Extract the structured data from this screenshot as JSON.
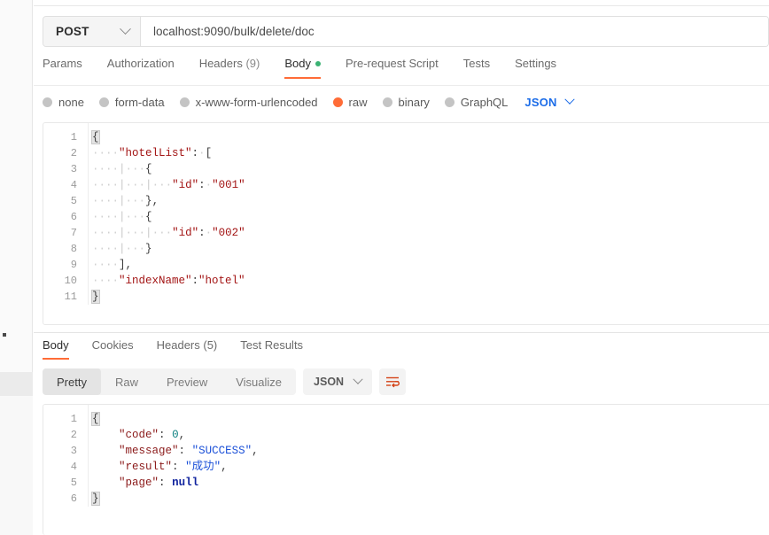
{
  "request": {
    "method": "POST",
    "url": "localhost:9090/bulk/delete/doc",
    "tabs": [
      {
        "label": "Params",
        "active": false,
        "count": ""
      },
      {
        "label": "Authorization",
        "active": false,
        "count": ""
      },
      {
        "label": "Headers",
        "active": false,
        "count": "(9)"
      },
      {
        "label": "Body",
        "active": true,
        "count": "",
        "dot": true
      },
      {
        "label": "Pre-request Script",
        "active": false,
        "count": ""
      },
      {
        "label": "Tests",
        "active": false,
        "count": ""
      },
      {
        "label": "Settings",
        "active": false,
        "count": ""
      }
    ],
    "body_types": [
      {
        "label": "none",
        "selected": false
      },
      {
        "label": "form-data",
        "selected": false
      },
      {
        "label": "x-www-form-urlencoded",
        "selected": false
      },
      {
        "label": "raw",
        "selected": true
      },
      {
        "label": "binary",
        "selected": false
      },
      {
        "label": "GraphQL",
        "selected": false
      }
    ],
    "format": "JSON",
    "body_lines": [
      {
        "n": "1",
        "segments": [
          {
            "t": "brace-hl",
            "v": "{"
          }
        ]
      },
      {
        "n": "2",
        "segments": [
          {
            "t": "ws",
            "v": "····"
          },
          {
            "t": "key",
            "v": "\"hotelList\""
          },
          {
            "t": "punc",
            "v": ":"
          },
          {
            "t": "ws",
            "v": "·"
          },
          {
            "t": "punc",
            "v": "["
          }
        ]
      },
      {
        "n": "3",
        "segments": [
          {
            "t": "ws",
            "v": "····"
          },
          {
            "t": "guide",
            "v": "|"
          },
          {
            "t": "ws",
            "v": "···"
          },
          {
            "t": "brace",
            "v": "{"
          }
        ]
      },
      {
        "n": "4",
        "segments": [
          {
            "t": "ws",
            "v": "····"
          },
          {
            "t": "guide",
            "v": "|"
          },
          {
            "t": "ws",
            "v": "···"
          },
          {
            "t": "guide",
            "v": "|"
          },
          {
            "t": "ws",
            "v": "···"
          },
          {
            "t": "key",
            "v": "\"id\""
          },
          {
            "t": "punc",
            "v": ":"
          },
          {
            "t": "ws",
            "v": "·"
          },
          {
            "t": "str",
            "v": "\"001\""
          }
        ]
      },
      {
        "n": "5",
        "segments": [
          {
            "t": "ws",
            "v": "····"
          },
          {
            "t": "guide",
            "v": "|"
          },
          {
            "t": "ws",
            "v": "···"
          },
          {
            "t": "brace",
            "v": "}"
          },
          {
            "t": "punc",
            "v": ","
          }
        ]
      },
      {
        "n": "6",
        "segments": [
          {
            "t": "ws",
            "v": "····"
          },
          {
            "t": "guide",
            "v": "|"
          },
          {
            "t": "ws",
            "v": "···"
          },
          {
            "t": "brace",
            "v": "{"
          }
        ]
      },
      {
        "n": "7",
        "segments": [
          {
            "t": "ws",
            "v": "····"
          },
          {
            "t": "guide",
            "v": "|"
          },
          {
            "t": "ws",
            "v": "···"
          },
          {
            "t": "guide",
            "v": "|"
          },
          {
            "t": "ws",
            "v": "···"
          },
          {
            "t": "key",
            "v": "\"id\""
          },
          {
            "t": "punc",
            "v": ":"
          },
          {
            "t": "ws",
            "v": "·"
          },
          {
            "t": "str",
            "v": "\"002\""
          }
        ]
      },
      {
        "n": "8",
        "segments": [
          {
            "t": "ws",
            "v": "····"
          },
          {
            "t": "guide",
            "v": "|"
          },
          {
            "t": "ws",
            "v": "···"
          },
          {
            "t": "brace",
            "v": "}"
          }
        ]
      },
      {
        "n": "9",
        "segments": [
          {
            "t": "ws",
            "v": "····"
          },
          {
            "t": "punc",
            "v": "]"
          },
          {
            "t": "punc",
            "v": ","
          }
        ]
      },
      {
        "n": "10",
        "segments": [
          {
            "t": "ws",
            "v": "····"
          },
          {
            "t": "key",
            "v": "\"indexName\""
          },
          {
            "t": "punc",
            "v": ":"
          },
          {
            "t": "str",
            "v": "\"hotel\""
          }
        ]
      },
      {
        "n": "11",
        "segments": [
          {
            "t": "brace-hl",
            "v": "}"
          }
        ]
      }
    ]
  },
  "response": {
    "tabs": [
      {
        "label": "Body",
        "active": true
      },
      {
        "label": "Cookies",
        "active": false
      },
      {
        "label": "Headers (5)",
        "active": false
      },
      {
        "label": "Test Results",
        "active": false
      }
    ],
    "views": [
      {
        "label": "Pretty",
        "active": true
      },
      {
        "label": "Raw",
        "active": false
      },
      {
        "label": "Preview",
        "active": false
      },
      {
        "label": "Visualize",
        "active": false
      }
    ],
    "format": "JSON",
    "wrap_icon": "word-wrap-icon",
    "body_lines": [
      {
        "n": "1",
        "segments": [
          {
            "t": "brace-hl",
            "v": "{"
          }
        ]
      },
      {
        "n": "2",
        "segments": [
          {
            "t": "ws",
            "v": "    "
          },
          {
            "t": "key2",
            "v": "\"code\""
          },
          {
            "t": "punc",
            "v": ":"
          },
          {
            "t": "ws",
            "v": " "
          },
          {
            "t": "num",
            "v": "0"
          },
          {
            "t": "punc",
            "v": ","
          }
        ]
      },
      {
        "n": "3",
        "segments": [
          {
            "t": "ws",
            "v": "    "
          },
          {
            "t": "key2",
            "v": "\"message\""
          },
          {
            "t": "punc",
            "v": ":"
          },
          {
            "t": "ws",
            "v": " "
          },
          {
            "t": "strb",
            "v": "\"SUCCESS\""
          },
          {
            "t": "punc",
            "v": ","
          }
        ]
      },
      {
        "n": "4",
        "segments": [
          {
            "t": "ws",
            "v": "    "
          },
          {
            "t": "key2",
            "v": "\"result\""
          },
          {
            "t": "punc",
            "v": ":"
          },
          {
            "t": "ws",
            "v": " "
          },
          {
            "t": "strb",
            "v": "\"成功\""
          },
          {
            "t": "punc",
            "v": ","
          }
        ]
      },
      {
        "n": "5",
        "segments": [
          {
            "t": "ws",
            "v": "    "
          },
          {
            "t": "key2",
            "v": "\"page\""
          },
          {
            "t": "punc",
            "v": ":"
          },
          {
            "t": "ws",
            "v": " "
          },
          {
            "t": "null",
            "v": "null"
          }
        ]
      },
      {
        "n": "6",
        "segments": [
          {
            "t": "brace-hl",
            "v": "}"
          }
        ]
      }
    ]
  },
  "colors": {
    "accent_orange": "#ff6c37",
    "accent_blue": "#1b6ce8",
    "dot_green": "#3bb273",
    "wrap_icon": "#d44317"
  }
}
